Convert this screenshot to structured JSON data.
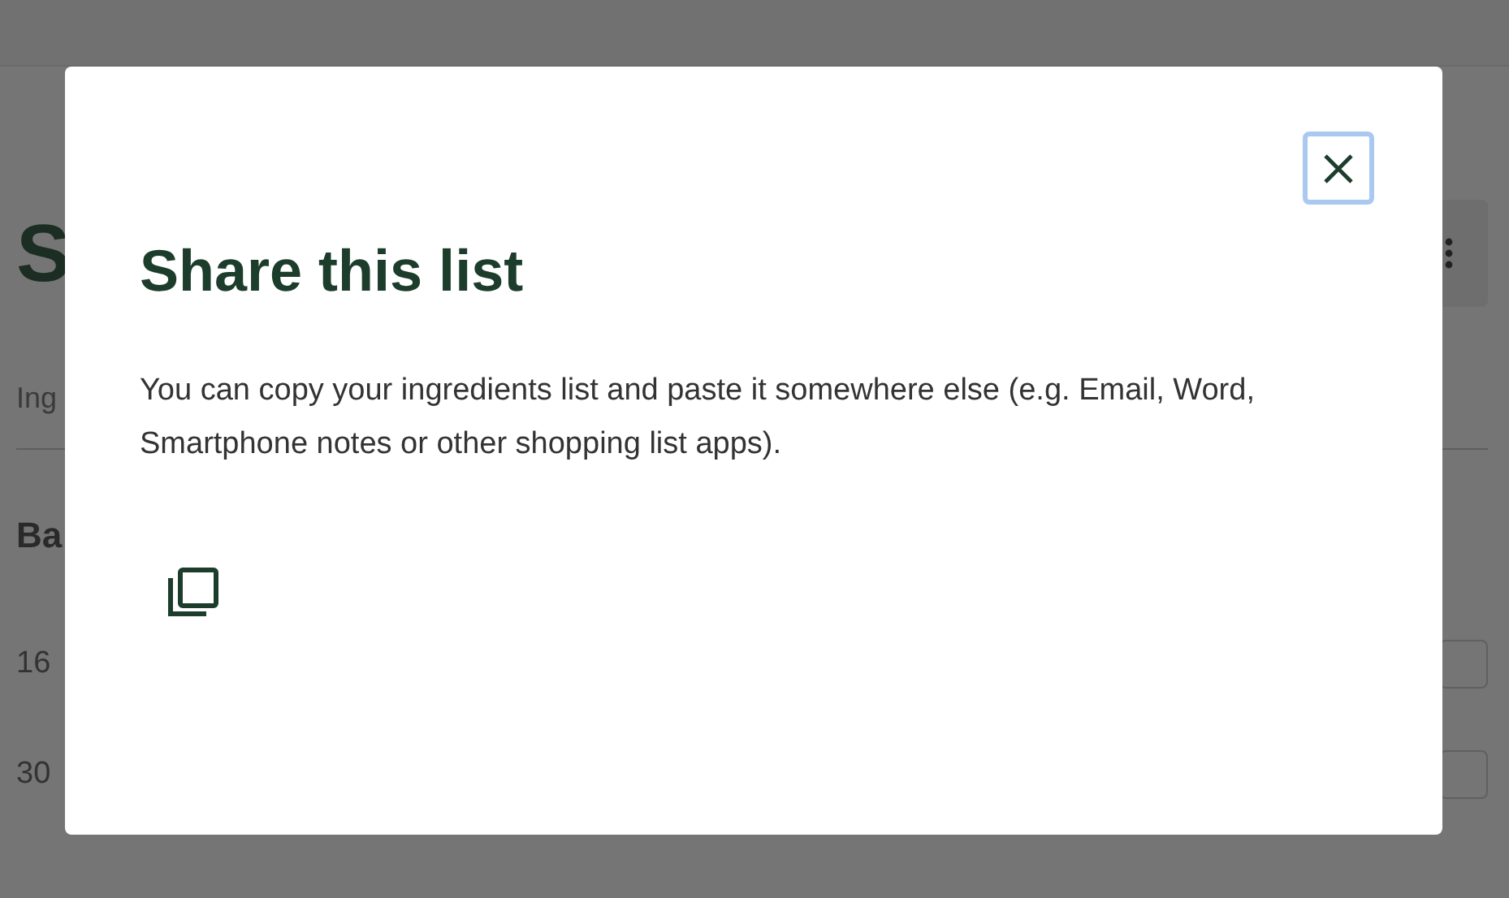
{
  "page": {
    "heading": "S",
    "tab": "Ing",
    "section": "Ba",
    "items": [
      {
        "text": "16",
        "checked": false
      },
      {
        "text": "30",
        "checked": false
      }
    ]
  },
  "dialog": {
    "title": "Share this list",
    "text": "You can copy your ingredients list and paste it somewhere else (e.g. Email, Word, Smartphone notes or other shopping list apps)."
  }
}
